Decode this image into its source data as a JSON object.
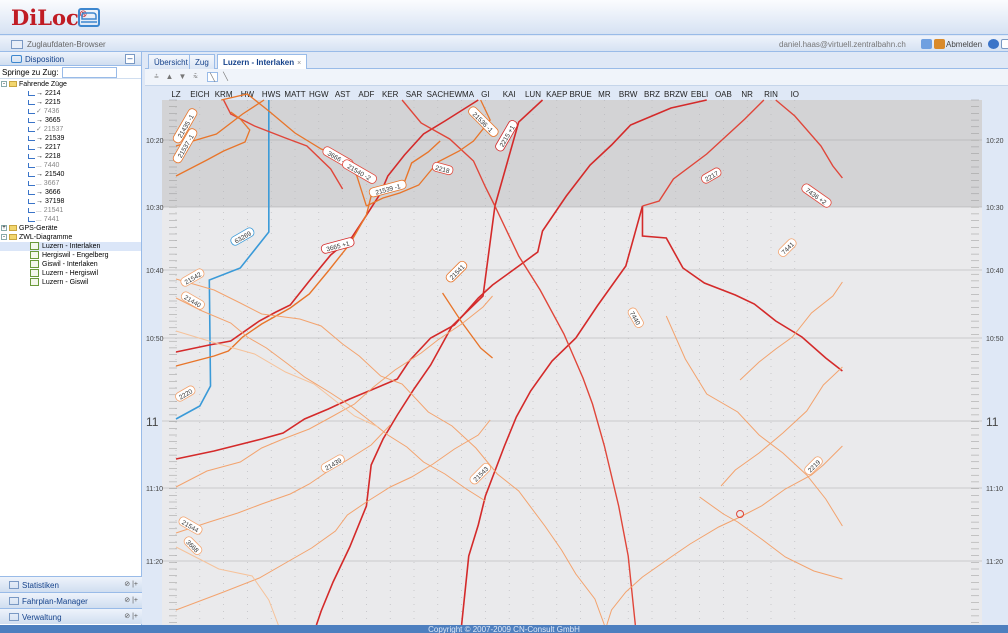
{
  "app": {
    "logo": "DiLoc",
    "logo_reg": "®",
    "title": "Zuglaufdaten-Browser",
    "user": "daniel.haas@virtuell.zentralbahn.ch",
    "logout": "Abmelden"
  },
  "sidebar": {
    "panel_title": "Disposition",
    "jump_label": "Springe zu Zug:",
    "jump_value": "",
    "groups": {
      "fahrende": "Fahrende Züge",
      "gps": "GPS-Geräte",
      "zwl": "ZWL-Diagramme"
    },
    "trains": [
      {
        "arrow": "→",
        "label": "2214",
        "dim": false
      },
      {
        "arrow": "→",
        "label": "2215",
        "dim": false
      },
      {
        "arrow": "✓",
        "label": "7436",
        "dim": true
      },
      {
        "arrow": "→",
        "label": "3665",
        "dim": false
      },
      {
        "arrow": "✓",
        "label": "21537",
        "dim": true
      },
      {
        "arrow": "→",
        "label": "21539",
        "dim": false
      },
      {
        "arrow": "→",
        "label": "2217",
        "dim": false
      },
      {
        "arrow": "→",
        "label": "2218",
        "dim": false
      },
      {
        "arrow": "...",
        "label": "7440",
        "dim": true
      },
      {
        "arrow": "→",
        "label": "21540",
        "dim": false
      },
      {
        "arrow": "...",
        "label": "3667",
        "dim": true
      },
      {
        "arrow": "→",
        "label": "3666",
        "dim": false
      },
      {
        "arrow": "→",
        "label": "37198",
        "dim": false
      },
      {
        "arrow": "...",
        "label": "21541",
        "dim": true
      },
      {
        "arrow": "...",
        "label": "7441",
        "dim": true
      }
    ],
    "diagrams": [
      {
        "label": "Luzern - Interlaken",
        "selected": true
      },
      {
        "label": "Hergiswil - Engelberg",
        "selected": false
      },
      {
        "label": "Giswil - Interlaken",
        "selected": false
      },
      {
        "label": "Luzern - Hergiswil",
        "selected": false
      },
      {
        "label": "Luzern - Giswil",
        "selected": false
      }
    ],
    "footer": {
      "statistiken": "Statistiken",
      "fahrplan": "Fahrplan-Manager",
      "verwaltung": "Verwaltung"
    }
  },
  "tabs": [
    {
      "label": "Übersicht",
      "active": false,
      "closable": false
    },
    {
      "label": "Zug",
      "active": false,
      "closable": false
    },
    {
      "label": "Luzern - Interlaken",
      "active": true,
      "closable": true
    }
  ],
  "diagram": {
    "stations": [
      "LZ",
      "EICH",
      "KRM",
      "HW",
      "HWS",
      "MATT",
      "HGW",
      "AST",
      "ADF",
      "KER",
      "SAR",
      "SACH",
      "EWMA",
      "GI",
      "KAI",
      "LUN",
      "KAEP",
      "BRUE",
      "MR",
      "BRW",
      "BRZ",
      "BRZW",
      "EBLI",
      "OAB",
      "NR",
      "RIN",
      "IO"
    ],
    "time_labels": [
      "10:20",
      "10:30",
      "10:40",
      "10:50",
      "11",
      "11:10",
      "11:20"
    ],
    "past_until": "10:30",
    "colors": {
      "dark_red": "#d42a2a",
      "red": "#e0463a",
      "orange": "#e8752a",
      "light_orange": "#f3a36e",
      "pale": "#f6c29a",
      "blue": "#3a9ad8"
    },
    "train_labels": [
      "21435 -1",
      "21537 -1",
      "3666 -1",
      "21540 -2",
      "21539 -1",
      "21536 -1",
      "2218",
      "2215 +1",
      "2217",
      "7436 +2",
      "63269",
      "3665 +1",
      "21541",
      "7441",
      "21542",
      "21440",
      "7440",
      "2220",
      "21439",
      "21543",
      "21544",
      "3668",
      "2219"
    ]
  },
  "status": {
    "copyright": "Copyright © 2007-2009 CN-Consult GmbH"
  }
}
